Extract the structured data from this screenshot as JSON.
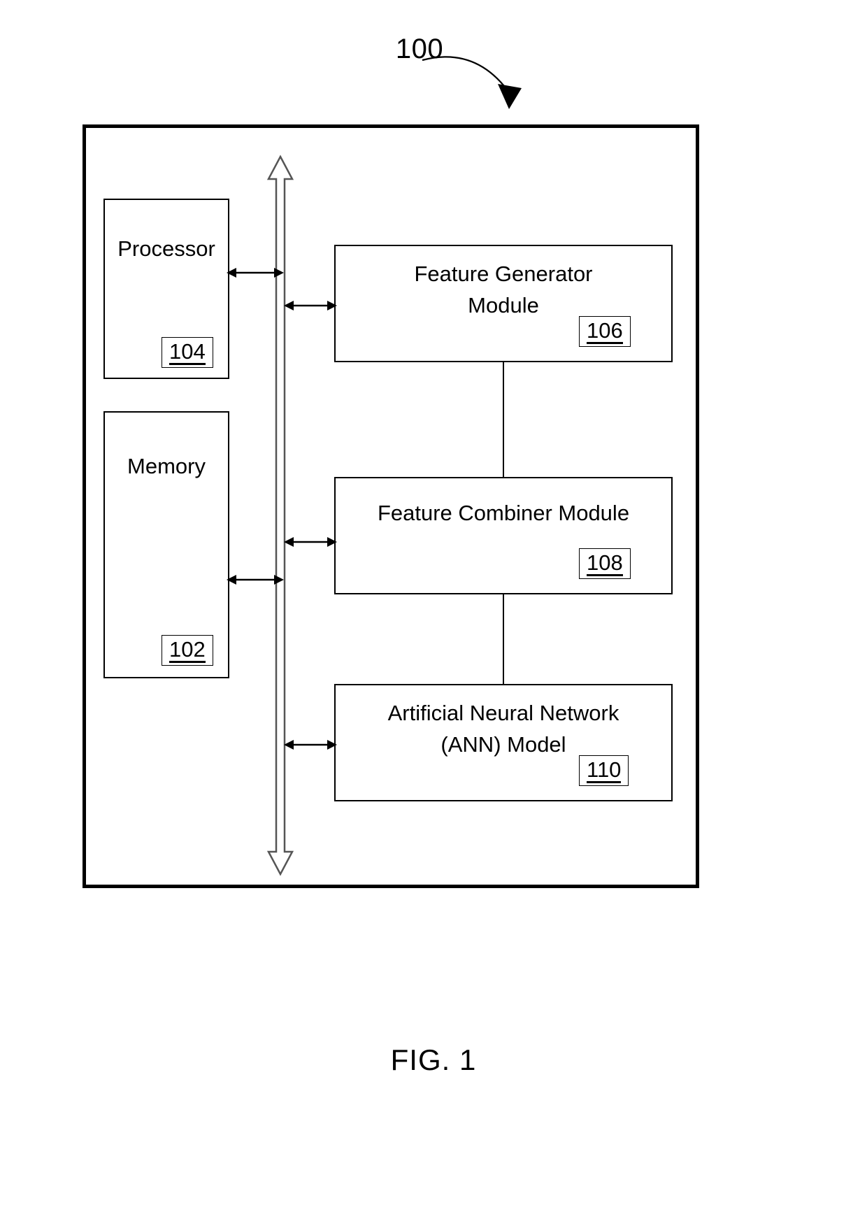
{
  "figure": {
    "caption": "FIG. 1",
    "system_ref": "100"
  },
  "system": {
    "ref": "100",
    "left_modules": [
      {
        "name": "processor",
        "title": "Processor",
        "ref": "104"
      },
      {
        "name": "memory",
        "title": "Memory",
        "ref": "102"
      }
    ],
    "right_modules": [
      {
        "name": "feature-generator-module",
        "title": "Feature Generator\nModule",
        "ref": "106"
      },
      {
        "name": "feature-combiner-module",
        "title": "Feature Combiner Module",
        "ref": "108"
      },
      {
        "name": "ann-model",
        "title": "Artificial Neural Network\n(ANN) Model",
        "ref": "110"
      }
    ],
    "bus": {
      "name": "system-bus",
      "style": "double-headed-vertical-arrow"
    }
  },
  "colors": {
    "stroke": "#000000",
    "background": "#ffffff"
  }
}
